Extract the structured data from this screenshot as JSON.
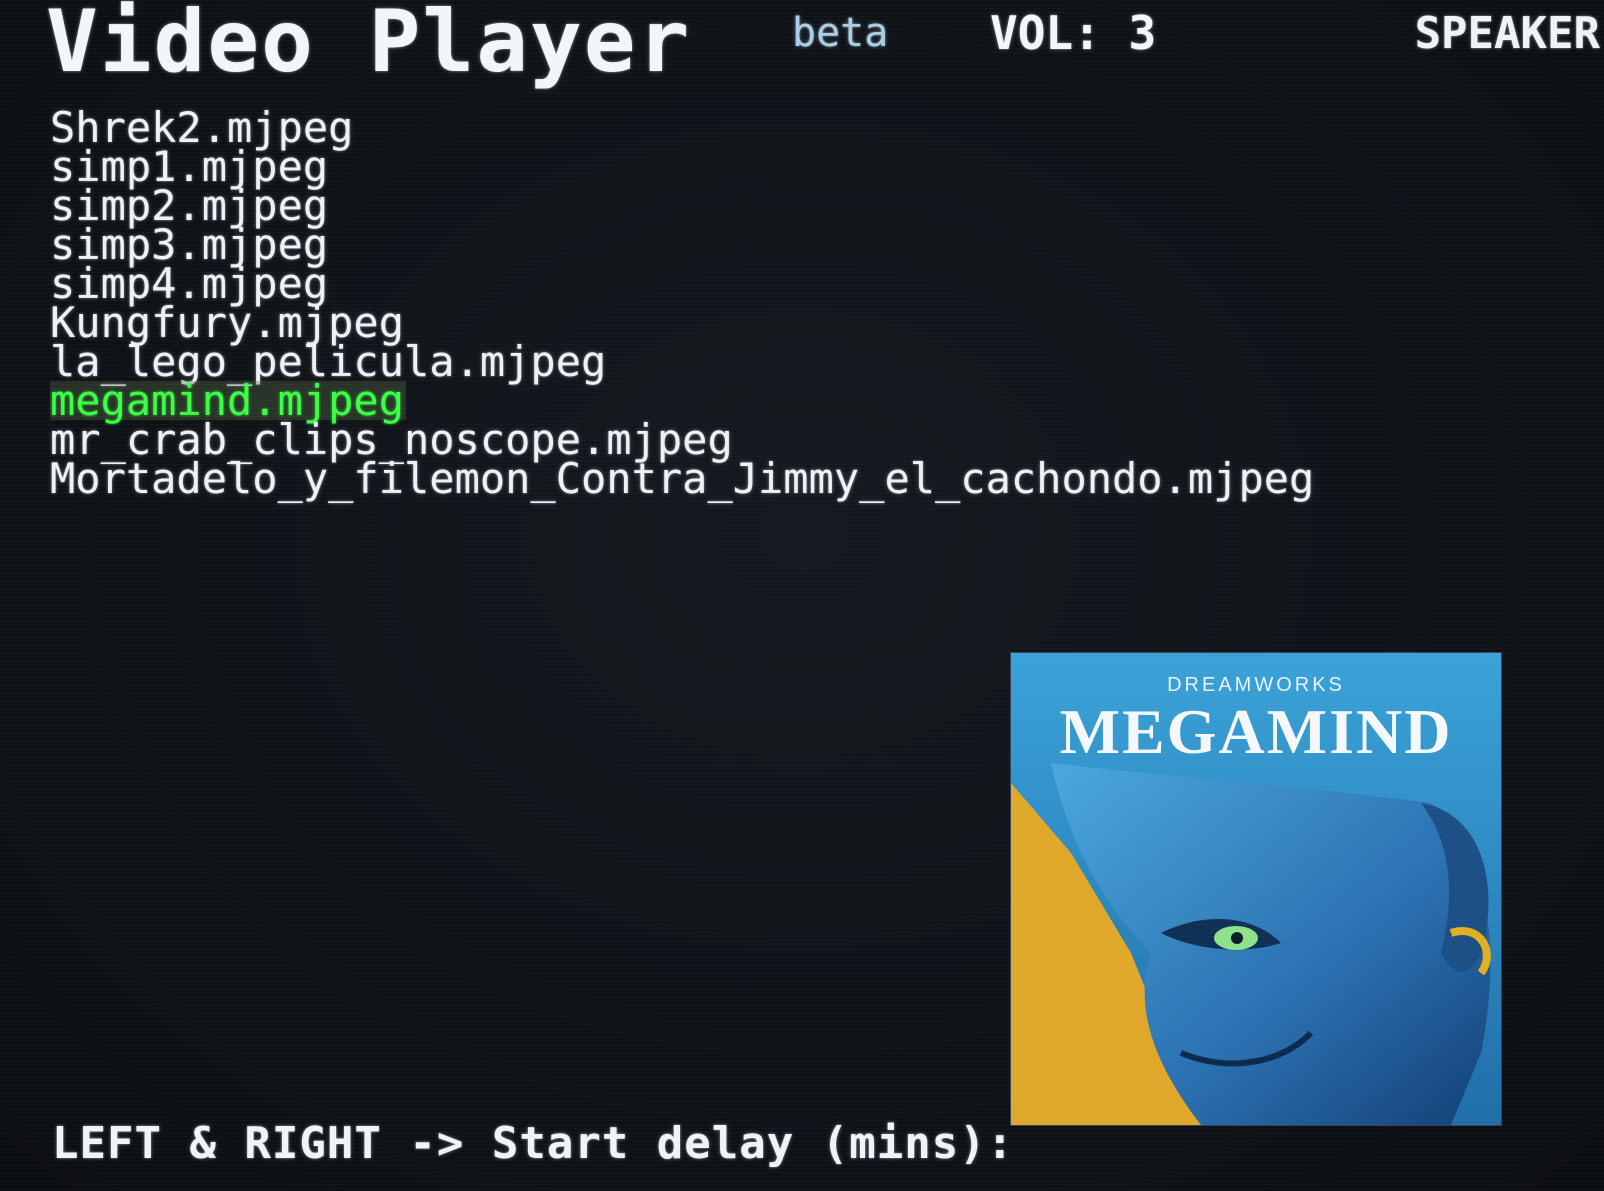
{
  "header": {
    "title": "Video Player",
    "beta_label": "beta",
    "volume": "VOL: 3",
    "output": "SPEAKER"
  },
  "files": [
    {
      "name": "Shrek2.mjpeg",
      "selected": false
    },
    {
      "name": "simp1.mjpeg",
      "selected": false
    },
    {
      "name": "simp2.mjpeg",
      "selected": false
    },
    {
      "name": "simp3.mjpeg",
      "selected": false
    },
    {
      "name": "simp4.mjpeg",
      "selected": false
    },
    {
      "name": "Kungfury.mjpeg",
      "selected": false
    },
    {
      "name": "la_lego_pelicula.mjpeg",
      "selected": false
    },
    {
      "name": "megamind.mjpeg",
      "selected": true
    },
    {
      "name": "mr_crab_clips_noscope.mjpeg",
      "selected": false
    },
    {
      "name": "Mortadelo_y_filemon_Contra_Jimmy_el_cachondo.mjpeg",
      "selected": false
    }
  ],
  "preview": {
    "studio": "DREAMWORKS",
    "title": "MEGAMIND"
  },
  "footer": {
    "hint": "LEFT & RIGHT -> Start delay (mins):"
  },
  "colors": {
    "background": "#0f1318",
    "text": "#eef2f4",
    "selected": "#39ff45",
    "beta": "#a9cfe6"
  }
}
